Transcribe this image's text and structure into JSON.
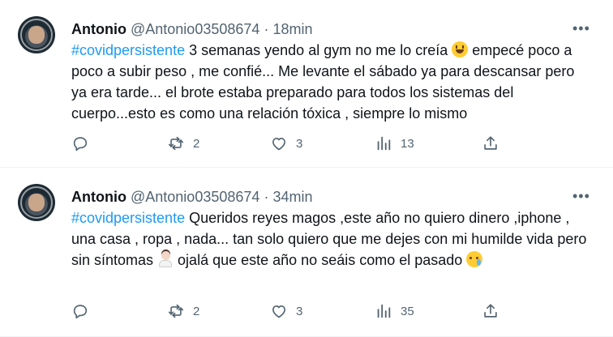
{
  "colors": {
    "accent": "#1d9bf0",
    "muted": "#536471",
    "text": "#0f1419"
  },
  "tweets": [
    {
      "name": "Antonio",
      "handle": "@Antonio03508674",
      "separator": "·",
      "time": "18min",
      "more_label": "•••",
      "hashtag": "#covidpersistente",
      "text_1": " 3 semanas yendo al gym no me lo creía ",
      "emoji_1": "smiling-face-emoji",
      "text_2": " empecé poco a poco a subir peso , me confié... Me levante el sábado ya para descansar pero ya era tarde... el brote estaba preparado para todos los sistemas del cuerpo...esto es como una relación tóxica , siempre lo mismo",
      "reply_count": "",
      "retweet_count": "2",
      "like_count": "3",
      "views_count": "13"
    },
    {
      "name": "Antonio",
      "handle": "@Antonio03508674",
      "separator": "·",
      "time": "34min",
      "more_label": "•••",
      "hashtag": "#covidpersistente",
      "text_1": " Queridos reyes magos ,este año no quiero dinero ,iphone , una casa , ropa , nada... tan solo quiero que me dejes con mi humilde vida pero sin síntomas ",
      "emoji_1": "person-gesturing-emoji",
      "text_2": " ojalá que este año no seáis como el pasado ",
      "emoji_2": "crying-face-emoji",
      "reply_count": "",
      "retweet_count": "2",
      "like_count": "3",
      "views_count": "35"
    }
  ]
}
